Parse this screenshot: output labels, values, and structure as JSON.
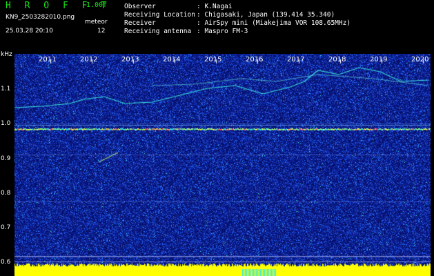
{
  "header": {
    "title": "H R O F F T",
    "version": "1.00f",
    "filename": "KN9_2503282010.png",
    "meteor_label": "meteor",
    "meteor_count": "12",
    "timestamp": "25.03.28 20:10",
    "info": [
      {
        "key": "Observer",
        "value": ": K.Nagai"
      },
      {
        "key": "Receiving Location",
        "value": ": Chigasaki, Japan (139.414 35.340)"
      },
      {
        "key": "Receiver",
        "value": ": AirSpy mini (Miakejima VOR 108.65MHz)"
      },
      {
        "key": "Receiving antenna",
        "value": ": Maspro FM-3"
      }
    ]
  },
  "spectrogram": {
    "unit_label": "kHz",
    "y_ticks": [
      "1.1",
      "1.0",
      "0.9",
      "0.8",
      "0.7",
      "0.6"
    ],
    "x_ticks": [
      "2011",
      "2012",
      "2013",
      "2014",
      "2015",
      "2016",
      "2017",
      "2018",
      "2019",
      "2020"
    ],
    "colors": {
      "background": "#0a1a8c",
      "noise": "#2a6cff",
      "trace": "#38e0e0",
      "strong": "#ffff40",
      "baseline": "#ffff00"
    }
  }
}
